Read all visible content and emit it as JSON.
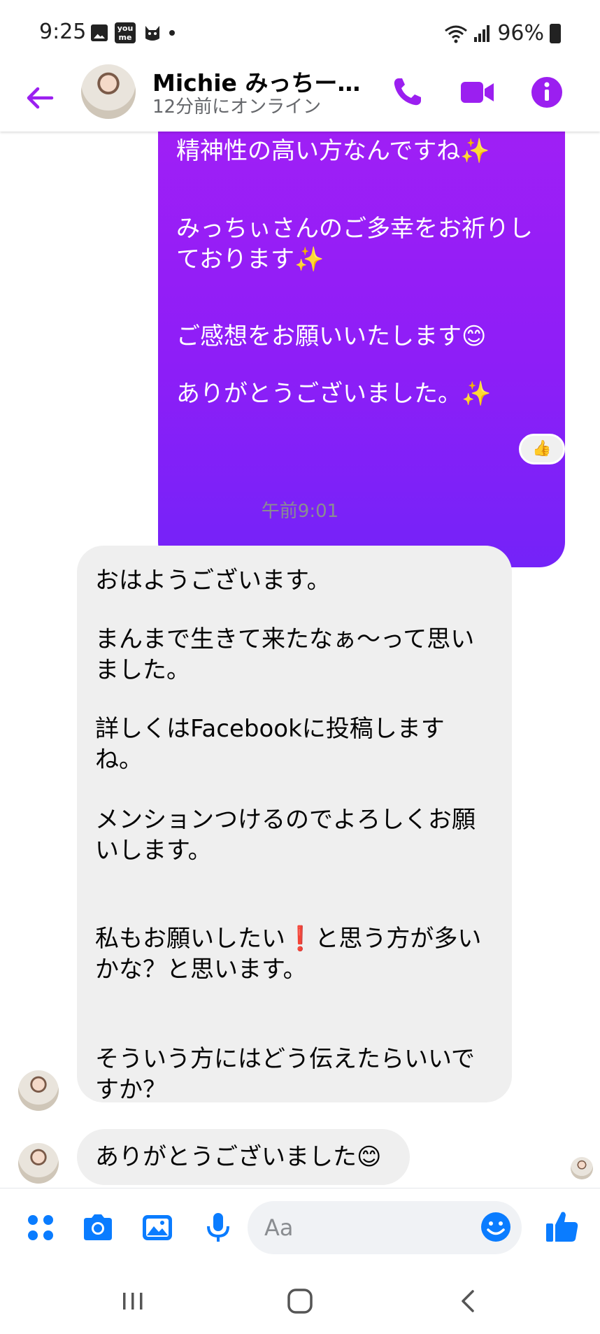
{
  "status_bar": {
    "time": "9:25",
    "youme_label": "you me",
    "battery": "96%"
  },
  "header": {
    "contact_name": "Michie みっちー…",
    "status": "12分前にオンライン",
    "accent_color": "#9b1ff0"
  },
  "messages": {
    "sent": {
      "lines": [
        "精神性の高い方なんですね✨",
        "みっちぃさんのご多幸をお祈りし",
        "ております✨",
        "ご感想をお願いいたします😊",
        "ありがとうございました。✨"
      ],
      "reaction": "👍"
    },
    "timestamp": "午前9:01",
    "received": {
      "lines": [
        "おはようございます。",
        "まんまで生きて来たなぁ〜って思い",
        "ました。",
        "詳しくはFacebookに投稿します",
        "ね。",
        "メンションつけるのでよろしくお願",
        "いします。",
        "私もお願いしたい❗と思う方が多い",
        "かな？と思います。",
        "そういう方にはどう伝えたらいいで",
        "すか？"
      ]
    },
    "received_2": "ありがとうございました😊"
  },
  "composer": {
    "placeholder": "Aa"
  },
  "icons": {
    "back": "arrow-left-icon",
    "call": "phone-icon",
    "video": "video-camera-icon",
    "info": "info-icon",
    "apps": "four-dots-icon",
    "camera": "camera-icon",
    "gallery": "image-icon",
    "mic": "microphone-icon",
    "emoji": "smiley-icon",
    "like": "thumbs-up-icon"
  }
}
